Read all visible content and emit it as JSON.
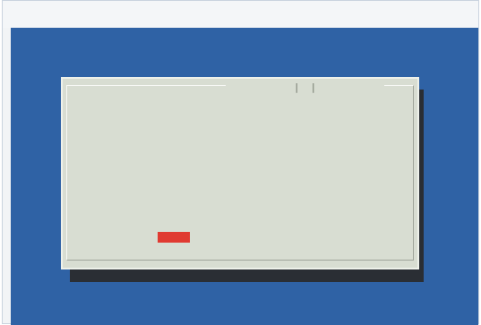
{
  "window": {
    "title": ""
  },
  "dialog": {
    "title": "",
    "message": "",
    "buttons": {
      "yes_label": "",
      "no_label": ""
    }
  },
  "colors": {
    "screen_background": "#2f62a5",
    "dialog_background": "#d8ddd2",
    "title_accent": "#c0392b",
    "selected_button": "#e03a31",
    "dialog_shadow": "#2a2e34"
  }
}
